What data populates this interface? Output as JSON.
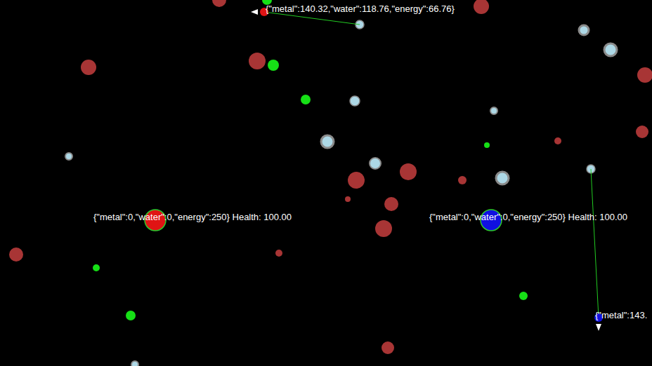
{
  "bases": [
    {
      "team": "red",
      "color": "#e01414",
      "label": "{\"metal\":0,\"water\":0,\"energy\":250} Health: 100.00"
    },
    {
      "team": "blue",
      "color": "#1010e0",
      "label": "{\"metal\":0,\"water\":0,\"energy\":250} Health: 100.00"
    }
  ],
  "ships": [
    {
      "team": "red",
      "color": "#e01414",
      "heading": "left",
      "mining": true,
      "label": "{\"metal\":140.32,\"water\":118.76,\"energy\":66.76}"
    },
    {
      "team": "blue",
      "color": "#1010e0",
      "heading": "down",
      "mining": true,
      "label": "{\"metal\":143."
    }
  ],
  "resources": [
    {
      "kind": "metal",
      "color": "#a83535"
    },
    {
      "kind": "metal",
      "color": "#a83535"
    },
    {
      "kind": "metal",
      "color": "#a83535"
    },
    {
      "kind": "metal",
      "color": "#a83535"
    },
    {
      "kind": "metal",
      "color": "#a83535"
    },
    {
      "kind": "metal",
      "color": "#a83535"
    },
    {
      "kind": "metal",
      "color": "#a83535"
    },
    {
      "kind": "metal",
      "color": "#a83535"
    },
    {
      "kind": "metal",
      "color": "#a83535"
    },
    {
      "kind": "metal",
      "color": "#a83535"
    },
    {
      "kind": "metal",
      "color": "#a83535"
    },
    {
      "kind": "metal",
      "color": "#a83535"
    },
    {
      "kind": "metal",
      "color": "#a83535"
    },
    {
      "kind": "metal",
      "color": "#a83535"
    },
    {
      "kind": "metal",
      "color": "#a83535"
    },
    {
      "kind": "metal",
      "color": "#a83535"
    },
    {
      "kind": "energy",
      "color": "#16e016"
    },
    {
      "kind": "energy",
      "color": "#16e016"
    },
    {
      "kind": "energy",
      "color": "#16e016"
    },
    {
      "kind": "energy",
      "color": "#16e016"
    },
    {
      "kind": "energy",
      "color": "#16e016"
    },
    {
      "kind": "energy",
      "color": "#16e016"
    },
    {
      "kind": "energy",
      "color": "#16e016"
    },
    {
      "kind": "water",
      "color": "#add8e6"
    },
    {
      "kind": "water",
      "color": "#add8e6"
    },
    {
      "kind": "water",
      "color": "#add8e6"
    },
    {
      "kind": "water",
      "color": "#add8e6"
    },
    {
      "kind": "water",
      "color": "#add8e6"
    },
    {
      "kind": "water",
      "color": "#add8e6"
    },
    {
      "kind": "water",
      "color": "#add8e6"
    },
    {
      "kind": "water",
      "color": "#add8e6"
    },
    {
      "kind": "water",
      "color": "#add8e6"
    },
    {
      "kind": "water",
      "color": "#add8e6"
    },
    {
      "kind": "water",
      "color": "#add8e6"
    }
  ]
}
